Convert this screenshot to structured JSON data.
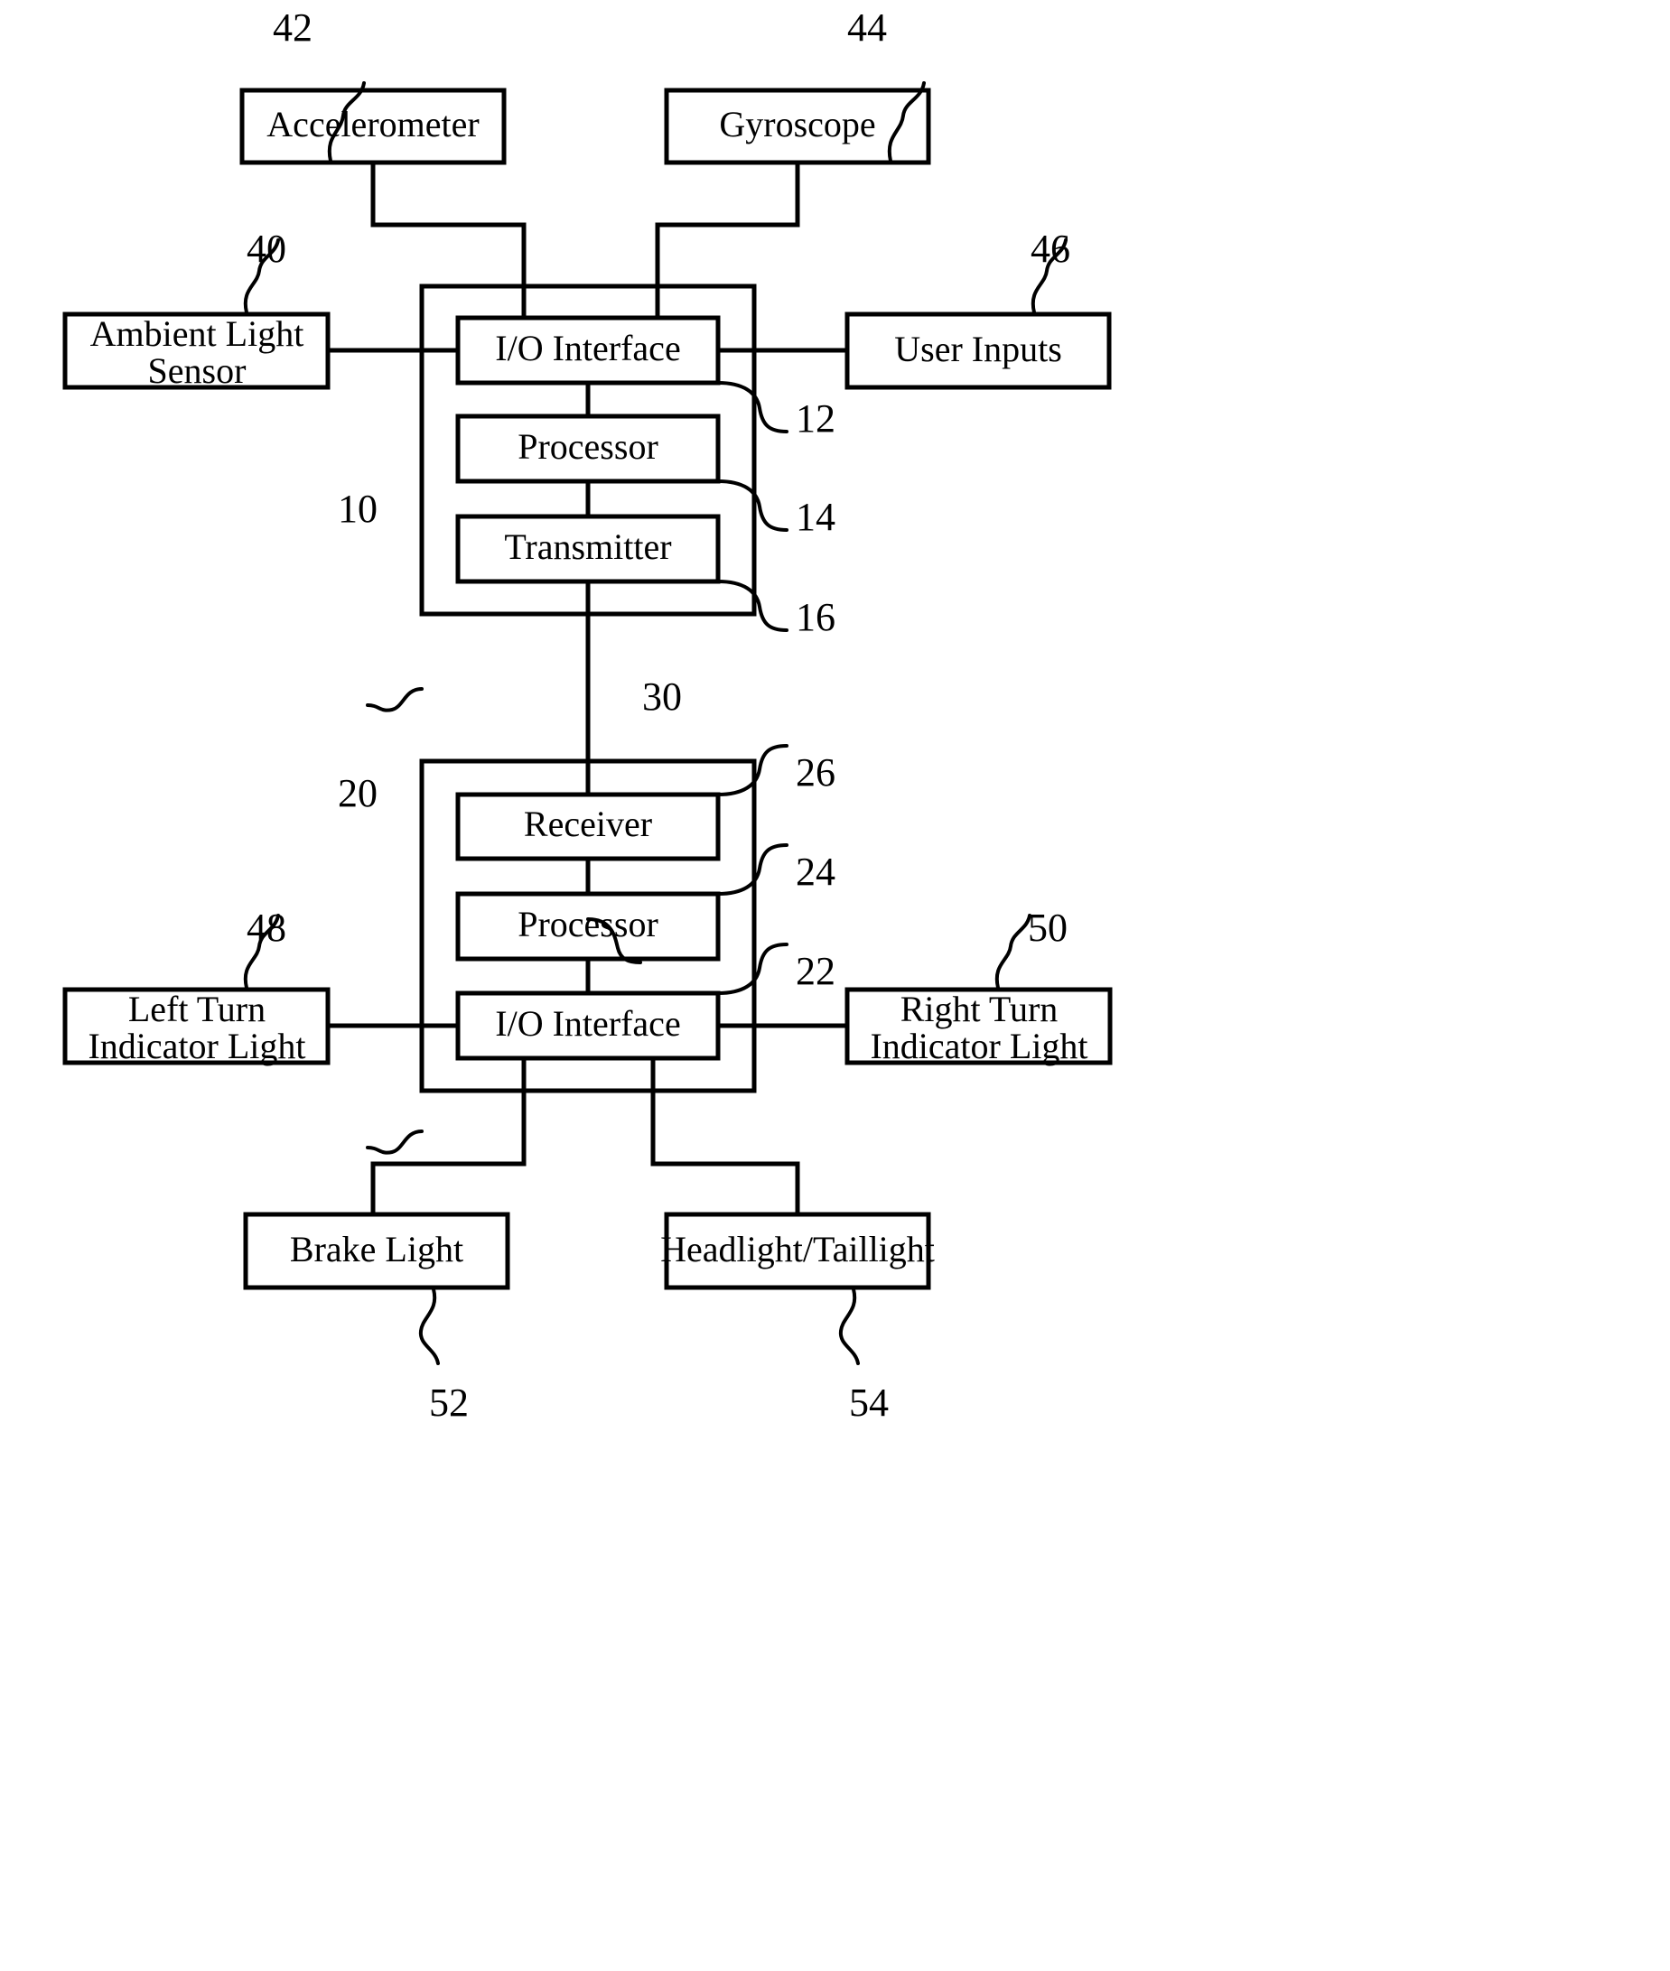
{
  "figure": {
    "type": "patent-block-diagram",
    "description": "Block diagram of a bicycle/vehicle signalling system with a transmitter unit and a receiver unit"
  },
  "blocks": {
    "accelerometer": {
      "label": "Accelerometer",
      "ref": "42"
    },
    "gyroscope": {
      "label": "Gyroscope",
      "ref": "44"
    },
    "ambient_light": {
      "label_line1": "Ambient Light",
      "label_line2": "Sensor",
      "ref": "40"
    },
    "user_inputs": {
      "label": "User Inputs",
      "ref": "46"
    },
    "upper_device": {
      "ref": "10"
    },
    "io_interface_upper": {
      "label": "I/O Interface",
      "ref": "12"
    },
    "processor_upper": {
      "label": "Processor",
      "ref": "14"
    },
    "transmitter": {
      "label": "Transmitter",
      "ref": "16"
    },
    "link": {
      "ref": "30"
    },
    "lower_device": {
      "ref": "20"
    },
    "receiver": {
      "label": "Receiver",
      "ref": "26"
    },
    "processor_lower": {
      "label": "Processor",
      "ref": "24"
    },
    "io_interface_lower": {
      "label": "I/O Interface",
      "ref": "22"
    },
    "left_turn": {
      "label_line1": "Left Turn",
      "label_line2": "Indicator Light",
      "ref": "48"
    },
    "right_turn": {
      "label_line1": "Right Turn",
      "label_line2": "Indicator Light",
      "ref": "50"
    },
    "brake_light": {
      "label": "Brake Light",
      "ref": "52"
    },
    "headlight": {
      "label": "Headlight/Taillight",
      "ref": "54"
    }
  },
  "colors": {
    "line": "#000000",
    "background": "#ffffff",
    "text": "#000000"
  }
}
